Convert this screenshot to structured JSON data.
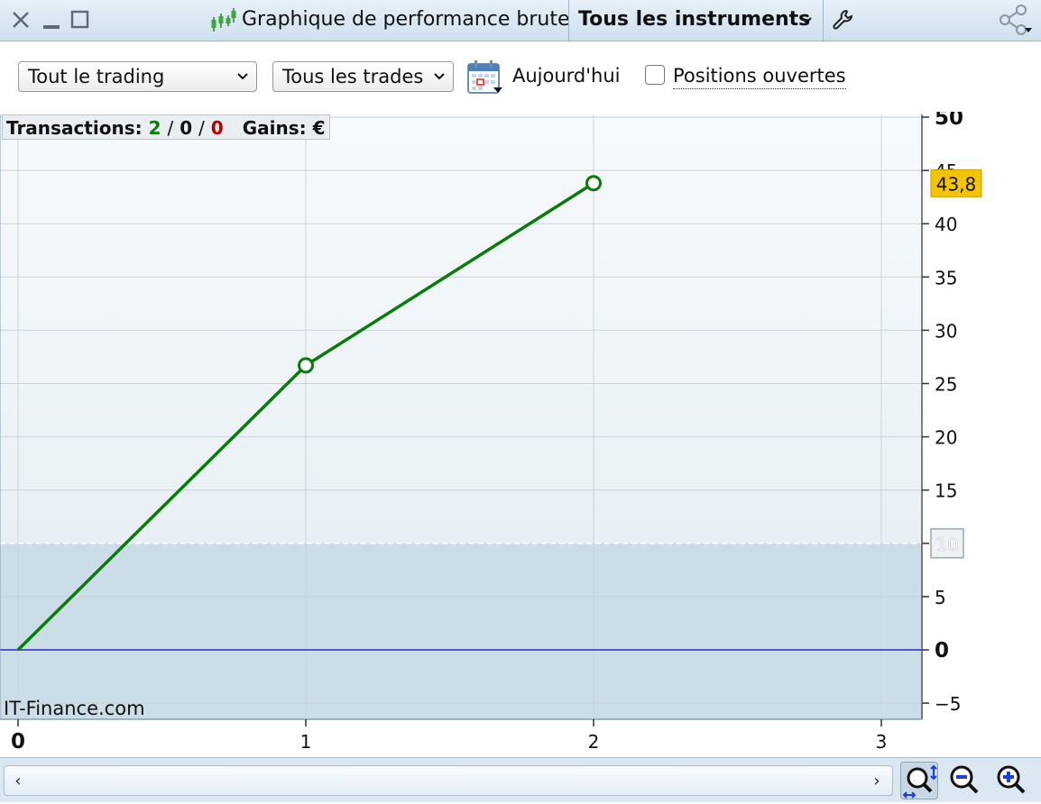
{
  "window": {
    "title": "Graphique de performance brute",
    "instruments_label": "Tous les instruments"
  },
  "toolbar": {
    "trading_select": "Tout le trading",
    "trades_select": "Tous les trades",
    "date_label": "Aujourd'hui",
    "open_positions_label": "Positions ouvertes",
    "open_positions_checked": false
  },
  "status": {
    "transactions_label": "Transactions:",
    "wins": "2",
    "neutral": "0",
    "losses": "0",
    "separator": "/",
    "gains_label": "Gains:",
    "currency": "€"
  },
  "watermark": "IT-Finance.com",
  "colors": {
    "line": "#0a7a0a",
    "wins": "#0a7a0a",
    "losses": "#b00000",
    "zero_line": "#2a2ad0",
    "last_value_badge": "#f5c400",
    "below_threshold_fill": "#cbdde7",
    "plot_top": "#f7fafc"
  },
  "chart_data": {
    "type": "line",
    "x": [
      0,
      1,
      2
    ],
    "series": [
      {
        "values": [
          0,
          26.7,
          43.8
        ]
      }
    ],
    "last_value_label": "43,8",
    "threshold": 10,
    "threshold_label": "10",
    "xlim": [
      0,
      3.1
    ],
    "ylim": [
      -6.5,
      50
    ],
    "x_ticks": [
      "0",
      "1",
      "2",
      "3"
    ],
    "y_ticks": [
      "50",
      "45",
      "40",
      "35",
      "30",
      "25",
      "20",
      "15",
      "10",
      "5",
      "0",
      "−5"
    ],
    "x_tick_values": [
      0,
      1,
      2,
      3
    ],
    "y_tick_values": [
      50,
      45,
      40,
      35,
      30,
      25,
      20,
      15,
      10,
      5,
      0,
      -5
    ],
    "grid": true,
    "title": "",
    "xlabel": "",
    "ylabel": ""
  }
}
